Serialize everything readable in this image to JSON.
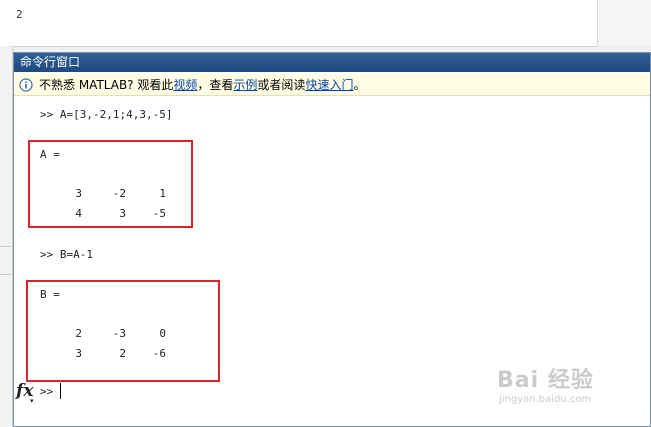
{
  "editor": {
    "line_number": "2"
  },
  "command_window": {
    "title": "命令行窗口",
    "info": {
      "prefix": "不熟悉 MATLAB? 观看此",
      "link_video": "视频",
      "middle1": "，查看",
      "link_examples": "示例",
      "middle2": "或者阅读",
      "link_getting_started": "快速入门",
      "suffix": "。"
    },
    "console": {
      "cmd1": ">> A=[3,-2,1;4,3,-5]",
      "var_a_label": "A =",
      "matrix_a": [
        [
          "3",
          "-2",
          "1"
        ],
        [
          "4",
          "3",
          "-5"
        ]
      ],
      "cmd2": ">> B=A-1",
      "var_b_label": "B =",
      "matrix_b": [
        [
          "2",
          "-3",
          "0"
        ],
        [
          "3",
          "2",
          "-6"
        ]
      ]
    },
    "prompt": {
      "fx_label": "fx",
      "fx_caret": "▾",
      "prompt_symbol": ">>"
    }
  },
  "watermark": {
    "brand": "Bai 经验",
    "url": "jingyan.baidu.com"
  },
  "colors": {
    "title_bar": "#2f5f97",
    "info_bar": "#fefde3",
    "highlight_box": "#d9262c",
    "link": "#0645ad"
  }
}
